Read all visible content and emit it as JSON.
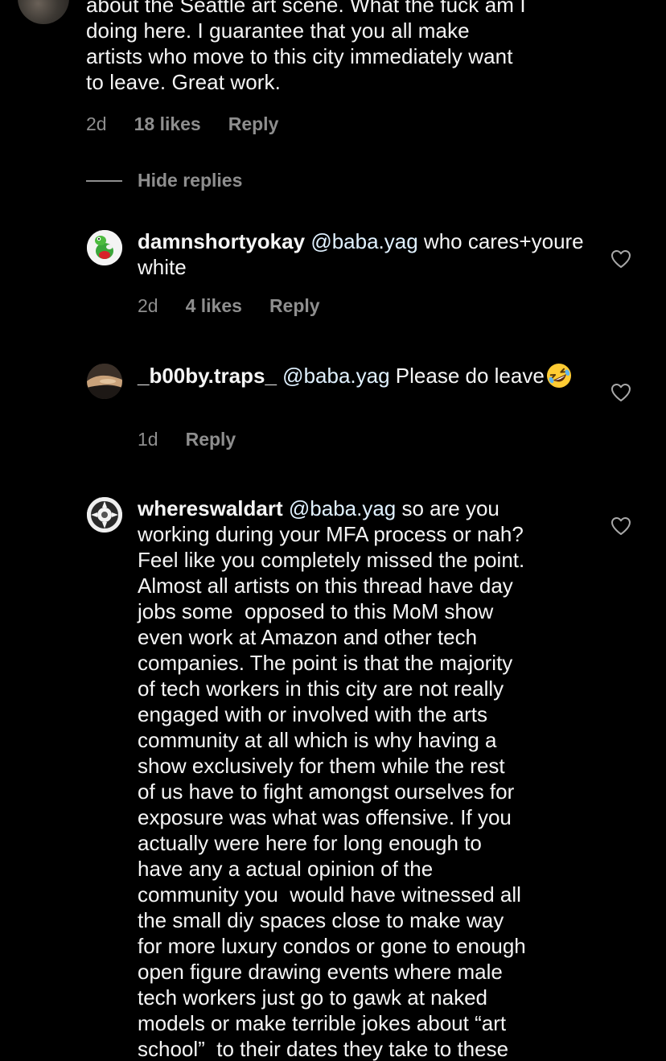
{
  "parent_comment": {
    "text_lines": [
      "about the Seattle art scene. What the fuck am I",
      "doing here. I guarantee that you all make",
      "artists who move to this city immediately want",
      "to leave. Great work."
    ],
    "time": "2d",
    "likes": "18 likes",
    "reply_label": "Reply"
  },
  "hide_replies_label": "Hide replies",
  "replies": [
    {
      "username": "damnshortyokay",
      "mention": "@baba.yag",
      "text": " who cares+youre white",
      "time": "2d",
      "likes": "4 likes",
      "reply_label": "Reply"
    },
    {
      "username": "_b00by.traps_",
      "mention": "@baba.yag",
      "text": " Please do leave",
      "emoji": "rolling-on-the-floor-laughing",
      "time": "1d",
      "reply_label": "Reply"
    },
    {
      "username": "whereswaldart",
      "mention": "@baba.yag",
      "lines": [
        " so are you",
        "working during your MFA process or nah?",
        "Feel like you completely missed the point.",
        "Almost all artists on this thread have day",
        "jobs some  opposed to this MoM show",
        "even work at Amazon and other tech",
        "companies. The point is that the majority",
        "of tech workers in this city are not really",
        "engaged with or involved with the arts",
        "community at all which is why having a",
        "show exclusively for them while the rest",
        "of us have to fight amongst ourselves for",
        "exposure was what was offensive. If you",
        "actually were here for long enough to",
        "have any a actual opinion of the",
        "community you  would have witnessed all",
        "the small diy spaces close to make way",
        "for more luxury condos or gone to enough",
        "open figure drawing events where male",
        "tech workers just go to gawk at naked",
        "models or make terrible jokes about “art",
        "school”  to their dates they take to these"
      ]
    }
  ]
}
